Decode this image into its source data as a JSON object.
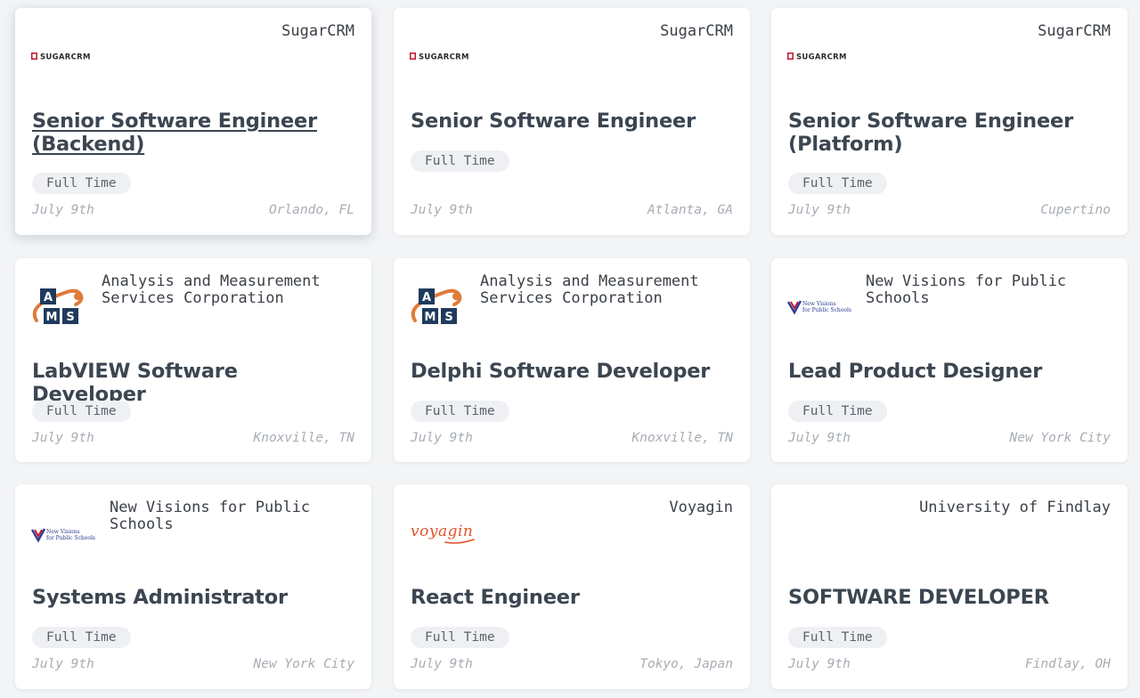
{
  "jobs": [
    {
      "company": "SugarCRM",
      "title": "Senior Software Engineer (Backend)",
      "type": "Full Time",
      "date": "July 9th",
      "location": "Orlando, FL",
      "logo": "sugarcrm-logo"
    },
    {
      "company": "SugarCRM",
      "title": "Senior Software Engineer",
      "type": "Full Time",
      "date": "July 9th",
      "location": "Atlanta, GA",
      "logo": "sugarcrm-logo"
    },
    {
      "company": "SugarCRM",
      "title": "Senior Software Engineer (Platform)",
      "type": "Full Time",
      "date": "July 9th",
      "location": "Cupertino",
      "logo": "sugarcrm-logo"
    },
    {
      "company": "Analysis and Measurement Services Corporation",
      "title": "LabVIEW Software Developer",
      "type": "Full Time",
      "date": "July 9th",
      "location": "Knoxville, TN",
      "logo": "ams-logo"
    },
    {
      "company": "Analysis and Measurement Services Corporation",
      "title": "Delphi Software Developer",
      "type": "Full Time",
      "date": "July 9th",
      "location": "Knoxville, TN",
      "logo": "ams-logo"
    },
    {
      "company": "New Visions for Public Schools",
      "title": "Lead Product Designer",
      "type": "Full Time",
      "date": "July 9th",
      "location": "New York City",
      "logo": "new-visions-logo"
    },
    {
      "company": "New Visions for Public Schools",
      "title": "Systems Administrator",
      "type": "Full Time",
      "date": "July 9th",
      "location": "New York City",
      "logo": "new-visions-logo"
    },
    {
      "company": "Voyagin",
      "title": "React Engineer",
      "type": "Full Time",
      "date": "July 9th",
      "location": "Tokyo, Japan",
      "logo": "voyagin-logo"
    },
    {
      "company": "University of Findlay",
      "title": "SOFTWARE DEVELOPER",
      "type": "Full Time",
      "date": "July 9th",
      "location": "Findlay, OH",
      "logo": ""
    }
  ],
  "logos": {
    "sugarcrm": "SUGARCRM",
    "new_visions": [
      "New Visions",
      "for Public Schools"
    ],
    "voyagin": "voyagin",
    "ams": [
      "A",
      "M",
      "S"
    ]
  },
  "colors": {
    "page_background": "#f2f4f6",
    "card_background": "#ffffff",
    "title": "#3c4651",
    "company": "#3b4148",
    "tag_background": "#eef0f3",
    "tag_text": "#5b636c",
    "meta_text": "#a7adb4",
    "sugar_red": "#c8102e",
    "ams_navy": "#1f3a5c",
    "ams_orange": "#e07b39",
    "voyagin_orange": "#e0532a",
    "new_visions_blue": "#2b3a8f"
  }
}
